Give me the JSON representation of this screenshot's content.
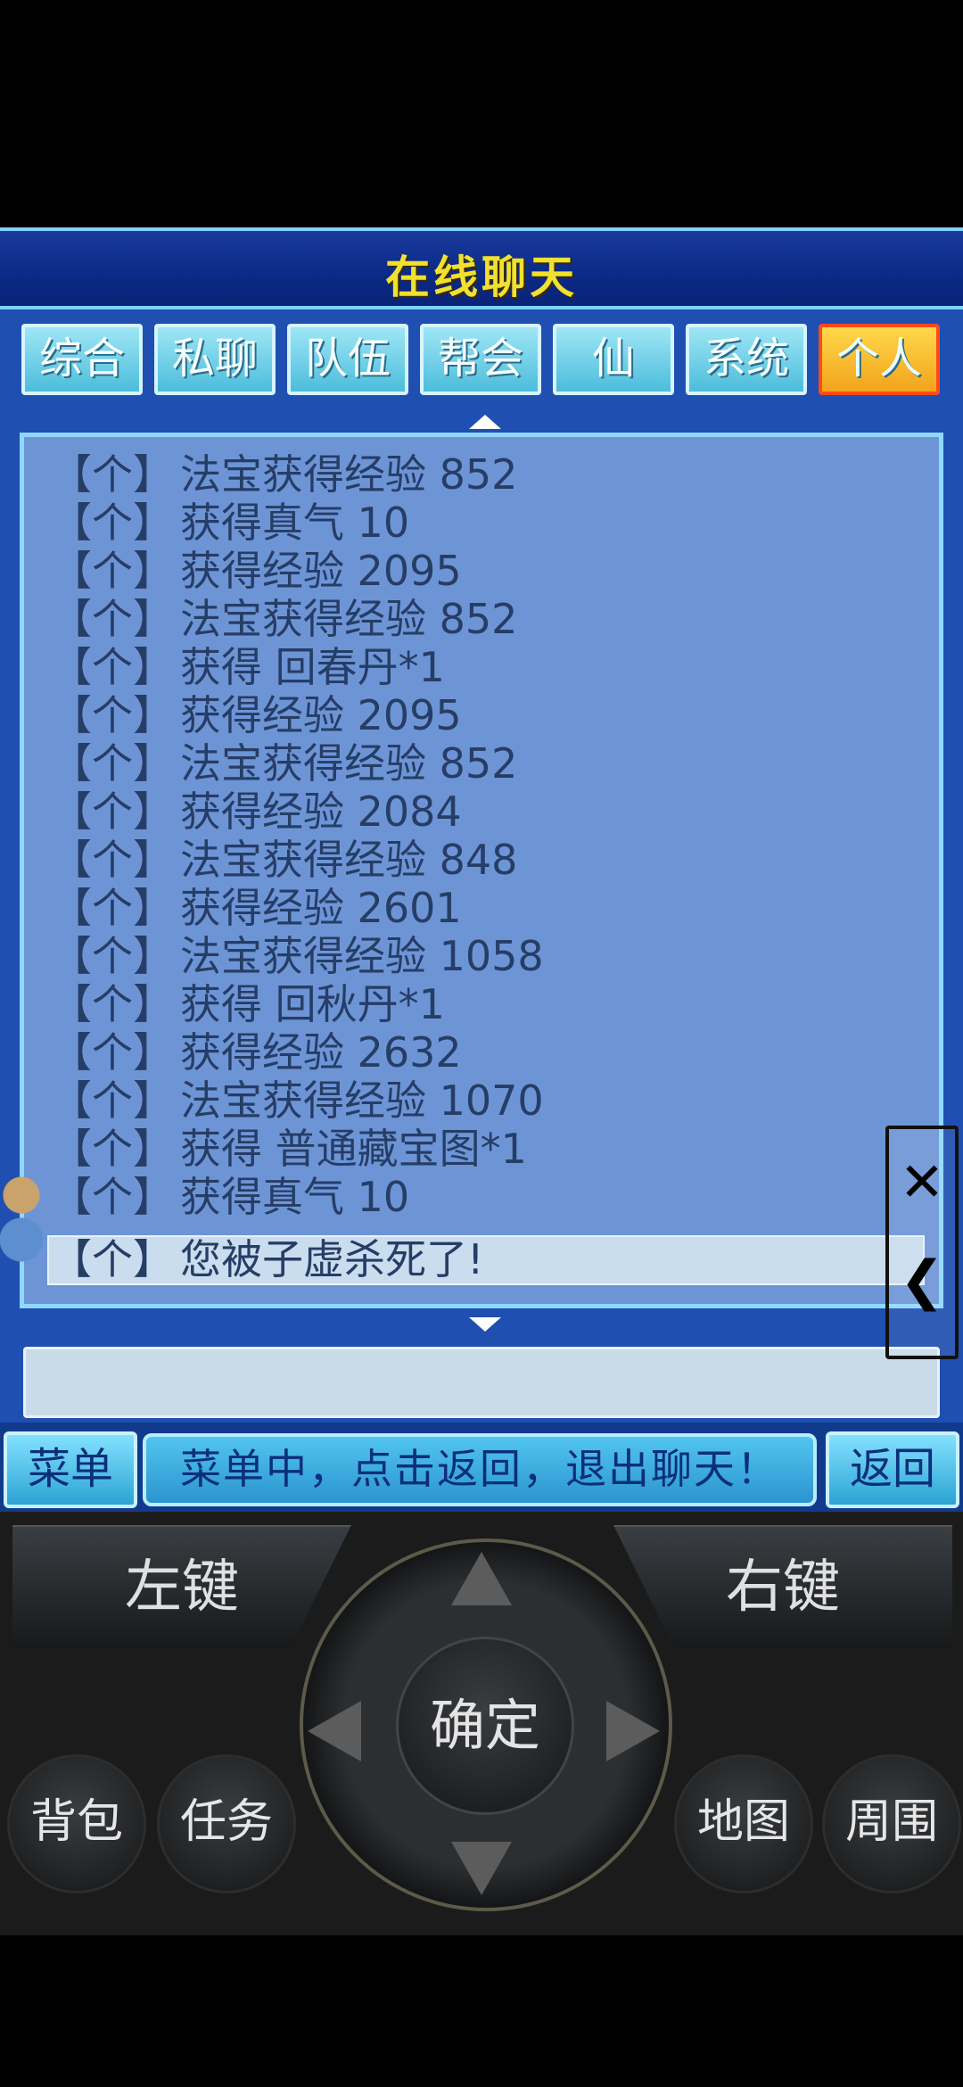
{
  "title": "在线聊天",
  "tabs": [
    {
      "label": "综合",
      "active": false
    },
    {
      "label": "私聊",
      "active": false
    },
    {
      "label": "队伍",
      "active": false
    },
    {
      "label": "帮会",
      "active": false
    },
    {
      "label": "仙",
      "active": false
    },
    {
      "label": "系统",
      "active": false
    },
    {
      "label": "个人",
      "active": true
    }
  ],
  "log": [
    {
      "tag": "【个】",
      "text": "法宝获得经验  852"
    },
    {
      "tag": "【个】",
      "text": "获得真气  10"
    },
    {
      "tag": "【个】",
      "text": "获得经验  2095"
    },
    {
      "tag": "【个】",
      "text": "法宝获得经验  852"
    },
    {
      "tag": "【个】",
      "text": "获得  回春丹*1"
    },
    {
      "tag": "【个】",
      "text": "获得经验  2095"
    },
    {
      "tag": "【个】",
      "text": "法宝获得经验  852"
    },
    {
      "tag": "【个】",
      "text": "获得经验  2084"
    },
    {
      "tag": "【个】",
      "text": "法宝获得经验  848"
    },
    {
      "tag": "【个】",
      "text": "获得经验  2601"
    },
    {
      "tag": "【个】",
      "text": "法宝获得经验  1058"
    },
    {
      "tag": "【个】",
      "text": "获得  回秋丹*1"
    },
    {
      "tag": "【个】",
      "text": "获得经验  2632"
    },
    {
      "tag": "【个】",
      "text": "法宝获得经验  1070"
    },
    {
      "tag": "【个】",
      "text": "获得  普通藏宝图*1"
    },
    {
      "tag": "【个】",
      "text": "获得真气  10"
    },
    {
      "tag": "【个】",
      "text": "您被子虚杀死了!"
    }
  ],
  "bottom": {
    "menu_label": "菜单",
    "hint": "菜单中，点击返回，退出聊天！",
    "back_label": "返回"
  },
  "side_controls": {
    "close_glyph": "✕",
    "back_glyph": "❮"
  },
  "keypad": {
    "left_soft": "左键",
    "right_soft": "右键",
    "ok": "确定",
    "bag": "背包",
    "task": "任务",
    "map": "地图",
    "around": "周围"
  },
  "colors": {
    "title": "#f0e030",
    "panel": "#6d95d6",
    "active_tab": "#f2a31c",
    "frame": "#1f4fb0"
  }
}
